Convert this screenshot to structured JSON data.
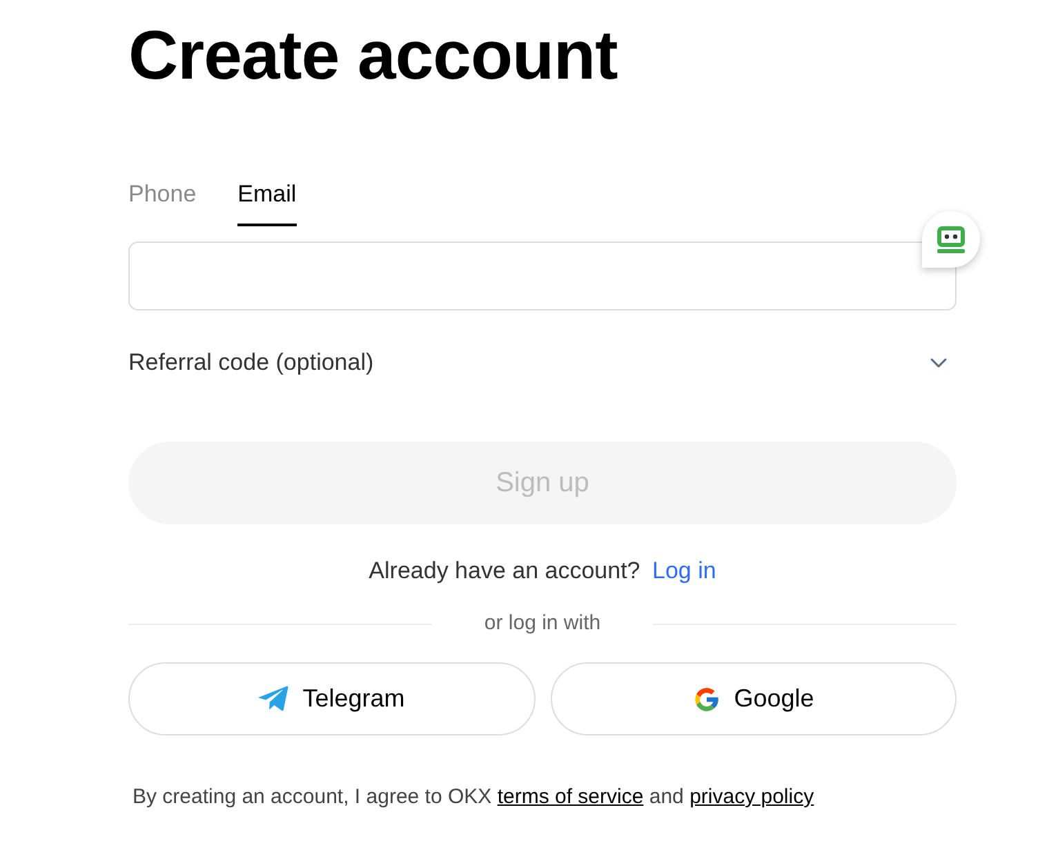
{
  "title": "Create account",
  "tabs": [
    {
      "label": "Phone",
      "selected": false
    },
    {
      "label": "Email",
      "selected": true
    }
  ],
  "referral": {
    "label": "Referral code (optional)",
    "expanded": false
  },
  "sign_up_button": {
    "label": "Sign up",
    "disabled": true
  },
  "login_prompt": {
    "text": "Already have an account?",
    "link": "Log in"
  },
  "divider_text": "or log in with",
  "social_buttons": [
    {
      "kind": "telegram",
      "label": "Telegram"
    },
    {
      "kind": "google",
      "label": "Google"
    }
  ],
  "terms": {
    "text": "By creating an account, I agree to OKX",
    "terms_link": "terms of service",
    "joiner": "and",
    "privacy_link": "privacy policy"
  }
}
